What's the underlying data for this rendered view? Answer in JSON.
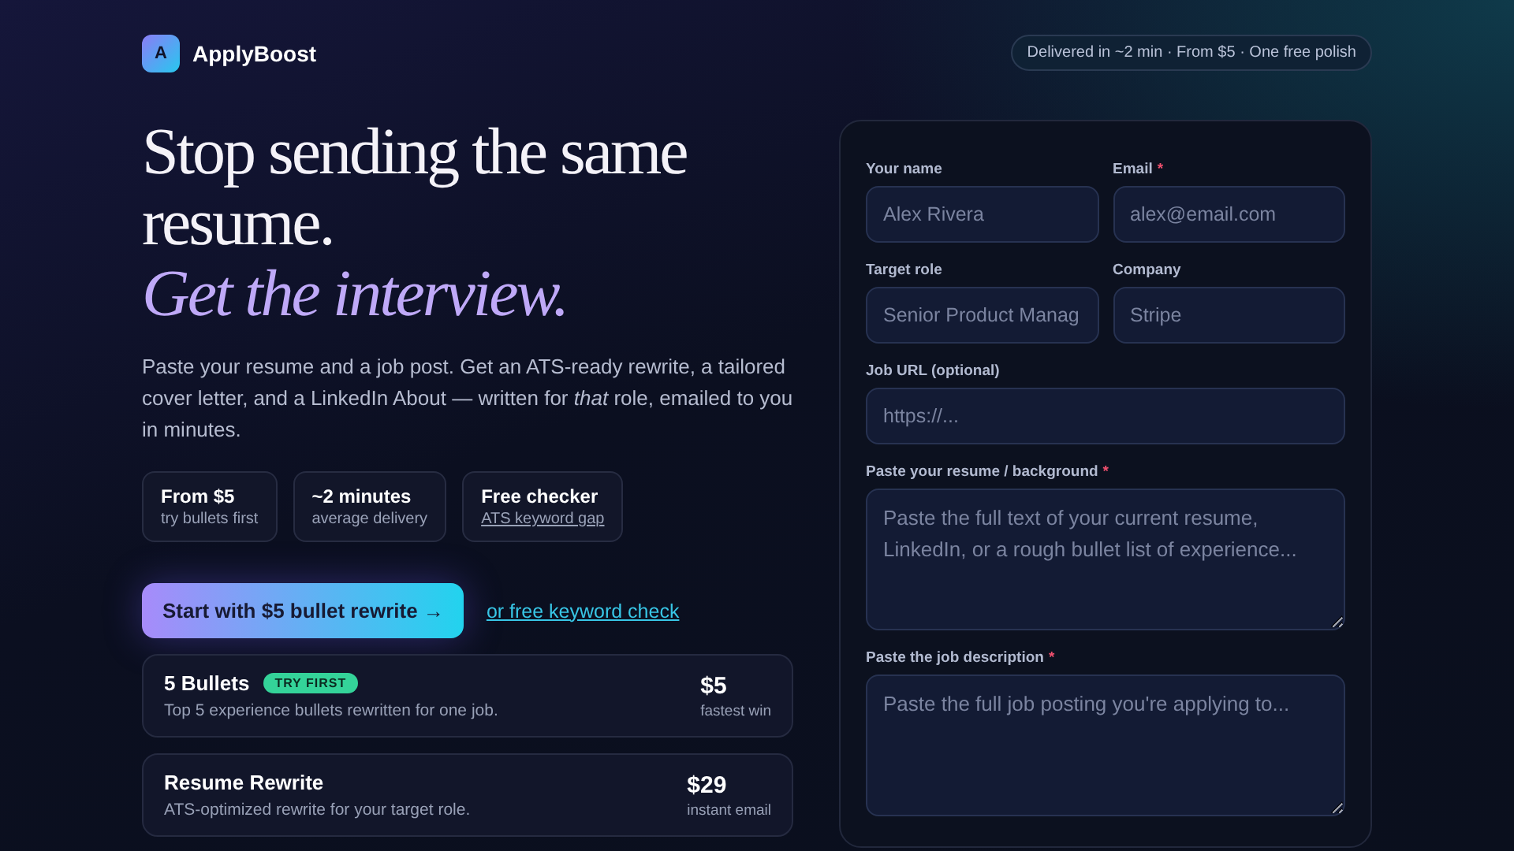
{
  "brand": {
    "logo_letter": "A",
    "name": "ApplyBoost"
  },
  "header_pill": "Delivered in ~2 min · From $5 · One free polish",
  "hero": {
    "title_lines": [
      "Stop sending the same",
      "resume."
    ],
    "title_accent": "Get the interview.",
    "lead": "Paste your resume and a job post. Get an ATS-ready rewrite, a tailored cover letter, and a LinkedIn About — written for *that* role, emailed to you in minutes."
  },
  "stats": [
    {
      "title": "From $5",
      "subtitle": "try bullets first",
      "kind": "text"
    },
    {
      "title": "~2 minutes",
      "subtitle": "average delivery",
      "kind": "text"
    },
    {
      "title": "Free checker",
      "subtitle": "ATS keyword gap",
      "kind": "link"
    }
  ],
  "cta": {
    "button": "Start with $5 bullet rewrite →",
    "link": "or free keyword check"
  },
  "plans": [
    {
      "name": "5 Bullets",
      "badge": "TRY FIRST",
      "description": "Top 5 experience bullets rewritten for one job.",
      "price": "$5",
      "note": "fastest win"
    },
    {
      "name": "Resume Rewrite",
      "description": "ATS-optimized rewrite for your target role.",
      "price": "$29",
      "note": "instant email"
    }
  ],
  "form": {
    "rows": [
      [
        {
          "label": "Your name",
          "placeholder": "Alex Rivera",
          "kind": "input"
        },
        {
          "label": "Email",
          "required_mark": "*",
          "placeholder": "alex@email.com",
          "kind": "input"
        }
      ],
      [
        {
          "label": "Target role",
          "placeholder": "Senior Product Manag",
          "kind": "input"
        },
        {
          "label": "Company",
          "placeholder": "Stripe",
          "kind": "input"
        }
      ],
      [
        {
          "label": "Job URL (optional)",
          "placeholder": "https://...",
          "kind": "input"
        }
      ],
      [
        {
          "label": "Paste your resume / background",
          "required_mark": "*",
          "placeholder": "Paste the full text of your current resume, LinkedIn, or a rough bullet list of experience...",
          "kind": "textarea"
        }
      ],
      [
        {
          "label": "Paste the job description",
          "required_mark": "*",
          "placeholder": "Paste the full job posting you're applying to...",
          "kind": "textarea"
        }
      ]
    ]
  }
}
